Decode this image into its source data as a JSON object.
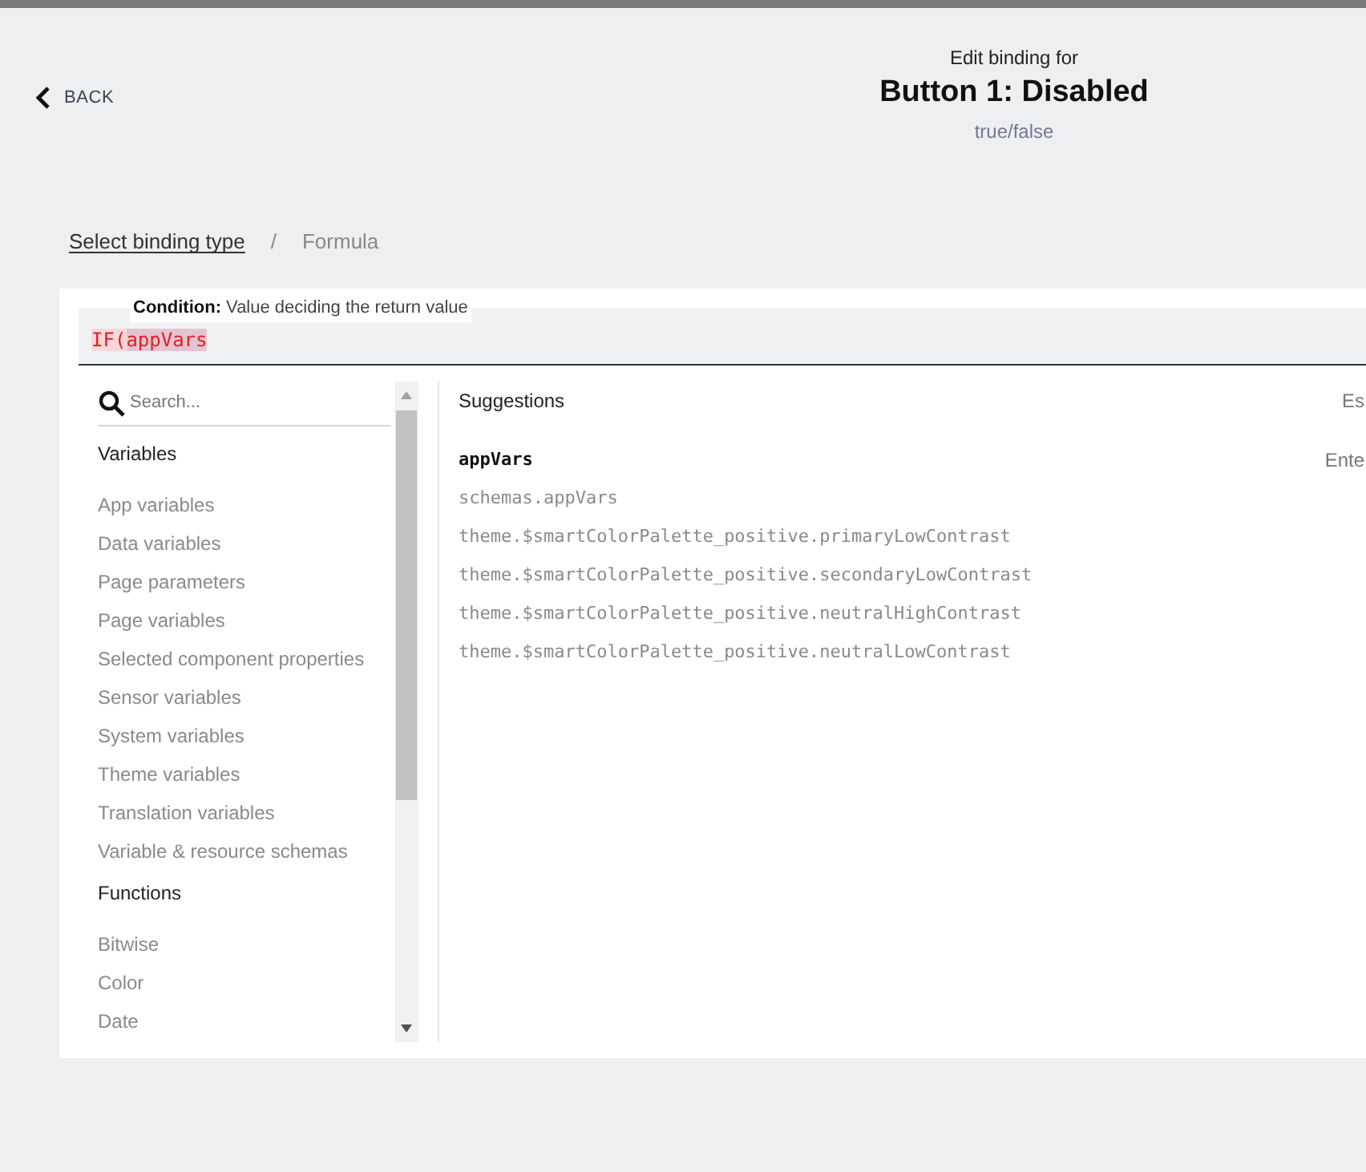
{
  "back": {
    "label": "BACK"
  },
  "header": {
    "subtitle": "Edit binding for",
    "title": "Button 1: Disabled",
    "type": "true/false"
  },
  "breadcrumb": [
    {
      "label": "Select binding type",
      "kind": "link"
    },
    {
      "label": "/",
      "kind": "separator"
    },
    {
      "label": "Formula",
      "kind": "current"
    }
  ],
  "tooltip": {
    "label": "Condition:",
    "text": "Value deciding the return value"
  },
  "formula": [
    {
      "text": "IF(",
      "highlighted": false
    },
    {
      "text": "appVars",
      "highlighted": true
    }
  ],
  "search": {
    "placeholder": "Search..."
  },
  "categories": [
    {
      "kind": "heading",
      "label": "Variables"
    },
    {
      "kind": "item",
      "label": "App variables"
    },
    {
      "kind": "item",
      "label": "Data variables"
    },
    {
      "kind": "item",
      "label": "Page parameters"
    },
    {
      "kind": "item",
      "label": "Page variables"
    },
    {
      "kind": "item",
      "label": "Selected component properties"
    },
    {
      "kind": "item",
      "label": "Sensor variables"
    },
    {
      "kind": "item",
      "label": "System variables"
    },
    {
      "kind": "item",
      "label": "Theme variables"
    },
    {
      "kind": "item",
      "label": "Translation variables"
    },
    {
      "kind": "item",
      "label": "Variable & resource schemas"
    },
    {
      "kind": "heading",
      "label": "Functions"
    },
    {
      "kind": "item",
      "label": "Bitwise"
    },
    {
      "kind": "item",
      "label": "Color"
    },
    {
      "kind": "item",
      "label": "Date"
    }
  ],
  "suggestions": {
    "title": "Suggestions",
    "hint": "Es",
    "selected_hint": "Ente",
    "items": [
      {
        "text": "appVars",
        "selected": true
      },
      {
        "text": "schemas.appVars",
        "selected": false
      },
      {
        "text": "theme.$smartColorPalette_positive.primaryLowContrast",
        "selected": false
      },
      {
        "text": "theme.$smartColorPalette_positive.secondaryLowContrast",
        "selected": false
      },
      {
        "text": "theme.$smartColorPalette_positive.neutralHighContrast",
        "selected": false
      },
      {
        "text": "theme.$smartColorPalette_positive.neutralLowContrast",
        "selected": false
      }
    ]
  }
}
